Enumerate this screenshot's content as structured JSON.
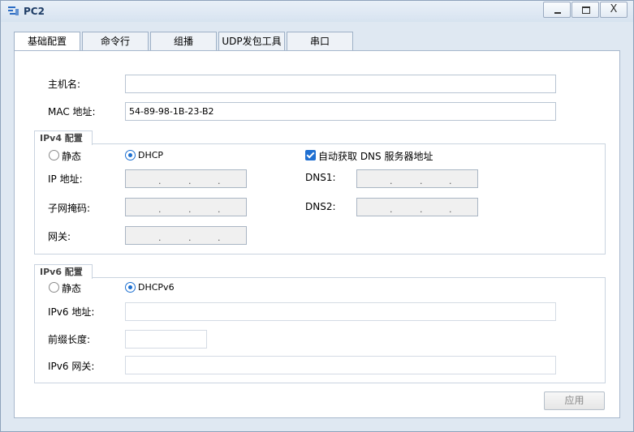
{
  "window": {
    "title": "PC2",
    "minimize": "−",
    "maximize": "□",
    "close": "X"
  },
  "tabs": [
    "基础配置",
    "命令行",
    "组播",
    "UDP发包工具",
    "串口"
  ],
  "active_tab": "基础配置",
  "basic": {
    "hostname_label": "主机名:",
    "hostname_value": "",
    "mac_label": "MAC 地址:",
    "mac_value": "54-89-98-1B-23-B2"
  },
  "ipv4": {
    "group_title": "IPv4 配置",
    "static_label": "静态",
    "dhcp_label": "DHCP",
    "mode": "DHCP",
    "auto_dns_label": "自动获取 DNS 服务器地址",
    "auto_dns_checked": true,
    "ip_label": "IP 地址:",
    "mask_label": "子网掩码:",
    "gateway_label": "网关:",
    "dns1_label": "DNS1:",
    "dns2_label": "DNS2:"
  },
  "ipv6": {
    "group_title": "IPv6 配置",
    "static_label": "静态",
    "dhcp_label": "DHCPv6",
    "mode": "DHCPv6",
    "addr_label": "IPv6 地址:",
    "prefix_label": "前缀长度:",
    "gateway_label": "IPv6 网关:"
  },
  "apply_label": "应用"
}
